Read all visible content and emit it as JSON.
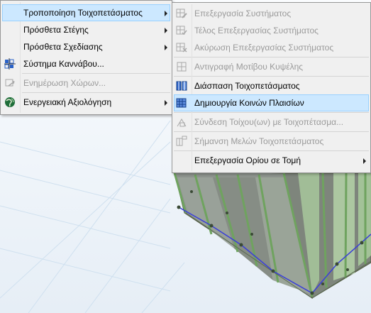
{
  "main_menu": {
    "items": [
      {
        "label": "Τροποποίηση Τοιχοπετάσματος",
        "has_submenu": true,
        "state": "highlighted"
      },
      {
        "label": "Πρόσθετα Στέγης",
        "has_submenu": true,
        "state": "normal"
      },
      {
        "label": "Πρόσθετα Σχεδίασης",
        "has_submenu": true,
        "state": "normal"
      },
      {
        "label": "Σύστημα Καννάβου...",
        "icon": "grid-system-icon",
        "state": "normal"
      },
      {
        "label": "Ενημέρωση Χώρων...",
        "icon": "zone-update-icon",
        "state": "disabled"
      },
      {
        "label": "Ενεργειακή Αξιολόγηση",
        "icon": "energy-globe-icon",
        "has_submenu": true,
        "state": "normal"
      }
    ]
  },
  "submenu": {
    "items": [
      {
        "label": "Επεξεργασία Συστήματος",
        "icon": "edit-system-icon",
        "state": "disabled"
      },
      {
        "label": "Τέλος Επεξεργασίας Συστήματος",
        "icon": "end-edit-icon",
        "state": "disabled"
      },
      {
        "label": "Ακύρωση Επεξεργασίας Συστήματος",
        "icon": "cancel-edit-icon",
        "state": "disabled"
      },
      {
        "label": "Αντιγραφή Μοτίβου Κυψέλης",
        "icon": "copy-pattern-icon",
        "state": "disabled"
      },
      {
        "label": "Διάσπαση Τοιχοπετάσματος",
        "icon": "explode-curtainwall-icon",
        "state": "normal"
      },
      {
        "label": "Δημιουργία Κοινών Πλαισίων",
        "icon": "create-frames-icon",
        "state": "highlighted"
      },
      {
        "label": "Σύνδεση Τοίχου(ων) με Τοιχοπέτασμα...",
        "icon": "connect-wall-icon",
        "state": "disabled"
      },
      {
        "label": "Σήμανση Μελών Τοιχοπετάσματος",
        "icon": "label-members-icon",
        "state": "disabled"
      },
      {
        "label": "Επεξεργασία Ορίου σε Τομή",
        "has_submenu": true,
        "state": "normal"
      }
    ]
  },
  "colors": {
    "highlight_fill": "#cce8ff",
    "highlight_border": "#99d1ff",
    "menu_bg": "#f0f0f0",
    "disabled_text": "#9a9a9a",
    "icon_blue": "#2a62c8"
  }
}
